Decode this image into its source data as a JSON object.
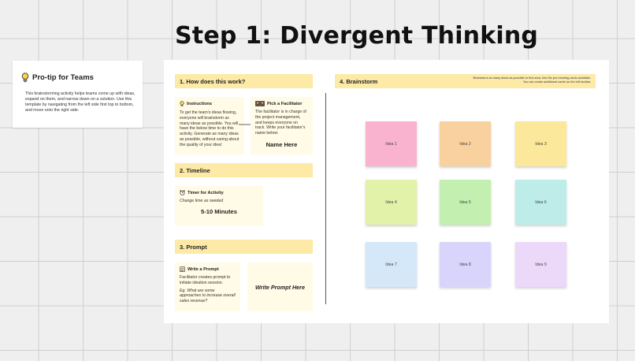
{
  "page": {
    "title": "Step 1: Divergent Thinking"
  },
  "tip": {
    "icon": "lightbulb-icon",
    "title": "Pro-tip for Teams",
    "body": "This brainstorming activity helps teams come up with ideas, expand on them, and narrow down on a solution. Use this template by navigating from the left side first top to bottom, and move onto the right side."
  },
  "how": {
    "header": "1. How does this work?",
    "instructions": {
      "icon": "lightbulb-icon",
      "title": "Instructions",
      "text": "To get the team's ideas flowing, everyone will brainstorm as many ideas as possible. You will have the below time to do this activity. Generate as many ideas as possible, without caring about the quality of your idea!"
    },
    "facilitator": {
      "icon": "people-icon",
      "title": "Pick a Facilitator",
      "text": "The facilitator is in charge of the project management, and keeps everyone on track. Write your facilitator's name below:",
      "name": "Name Here"
    }
  },
  "timeline": {
    "header": "2. Timeline",
    "timer": {
      "icon": "alarm-clock-icon",
      "title": "Timer for Activity",
      "note": "Change time as needed",
      "value": "5-10 Minutes"
    }
  },
  "prompt": {
    "header": "3. Prompt",
    "write": {
      "icon": "notepad-icon",
      "title": "Write a Prompt",
      "text": "Facilitator creates prompt to initiate ideation session.",
      "example": "Eg. What are some approaches to increase overall sales revenue?"
    },
    "placeholder": "Write Prompt Here"
  },
  "brainstorm": {
    "header": "4. Brainstorm",
    "hint": "Brainstorm as many ideas as possible in this area. Use the pre-existing cards available. You can create additional cards on the left toolbar.",
    "stickies": [
      {
        "label": "Idea 1",
        "color": "#f9b3cf"
      },
      {
        "label": "Idea 2",
        "color": "#f8d19e"
      },
      {
        "label": "Idea 3",
        "color": "#fbe89a"
      },
      {
        "label": "Idea 4",
        "color": "#e2f2a8"
      },
      {
        "label": "Idea 5",
        "color": "#c3efb0"
      },
      {
        "label": "Idea 6",
        "color": "#bdece9"
      },
      {
        "label": "Idea 7",
        "color": "#d4e8f9"
      },
      {
        "label": "Idea 8",
        "color": "#d9d4fb"
      },
      {
        "label": "Idea 9",
        "color": "#ecd9f9"
      }
    ]
  },
  "colors": {
    "header_yellow": "#fdeaa7",
    "card_yellow": "#fffbe6",
    "canvas": "#efefef"
  }
}
